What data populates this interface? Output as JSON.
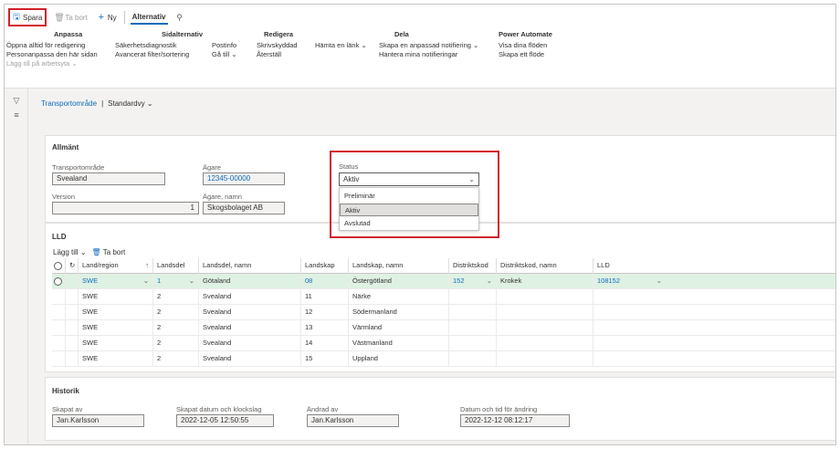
{
  "toolbar": {
    "save": "Spara",
    "delete": "Ta bort",
    "new": "Ny",
    "options_tab": "Alternativ"
  },
  "ribbon": {
    "anpassa": {
      "title": "Anpassa",
      "items": [
        "Öppna alltid för redigering",
        "Personanpassa den här sidan",
        "Lägg till på arbetsyta"
      ]
    },
    "sidalternativ": {
      "title": "Sidalternativ",
      "col1": [
        "Säkerhetsdiagnostik",
        "Avancerat filter/sortering"
      ],
      "col2": [
        "Postinfo",
        "Gå till"
      ]
    },
    "redigera": {
      "title": "Redigera",
      "items": [
        "Skrivskyddad",
        "Återställ"
      ]
    },
    "dela": {
      "title": "Dela",
      "link": "Hämta en länk",
      "items": [
        "Skapa en anpassad notifiering",
        "Hantera mina notifieringar"
      ]
    },
    "power_automate": {
      "title": "Power Automate",
      "items": [
        "Visa dina flöden",
        "Skapa ett flöde"
      ]
    }
  },
  "breadcrumb": {
    "entity": "Transportområde",
    "separator": "|",
    "view": "Standardvy"
  },
  "general": {
    "title": "Allmänt",
    "transport_area_label": "Transportområde",
    "transport_area_value": "Svealand",
    "owner_label": "Ägare",
    "owner_value": "12345-00000",
    "version_label": "Version",
    "version_value": "1",
    "owner_name_label": "Ägare, namn",
    "owner_name_value": "Skogsbolaget AB",
    "status_label": "Status",
    "status_value": "Aktiv",
    "status_options": [
      "Preliminär",
      "Aktiv",
      "Avslutad"
    ]
  },
  "lld": {
    "title": "LLD",
    "add": "Lägg till",
    "remove": "Ta bort",
    "columns": [
      "Land/region",
      "Landsdel",
      "Landsdel, namn",
      "Landskap",
      "Landskap, namn",
      "Distriktskod",
      "Distriktskod, namn",
      "LLD"
    ],
    "rows": [
      [
        "SWE",
        "1",
        "Götaland",
        "08",
        "Östergötland",
        "152",
        "Krokek",
        "108152"
      ],
      [
        "SWE",
        "2",
        "Svealand",
        "11",
        "Närke",
        "",
        "",
        ""
      ],
      [
        "SWE",
        "2",
        "Svealand",
        "12",
        "Södermanland",
        "",
        "",
        ""
      ],
      [
        "SWE",
        "2",
        "Svealand",
        "13",
        "Värmland",
        "",
        "",
        ""
      ],
      [
        "SWE",
        "2",
        "Svealand",
        "14",
        "Västmanland",
        "",
        "",
        ""
      ],
      [
        "SWE",
        "2",
        "Svealand",
        "15",
        "Uppland",
        "",
        "",
        ""
      ]
    ]
  },
  "history": {
    "title": "Historik",
    "created_by_label": "Skapat av",
    "created_by_value": "Jan.Karlsson",
    "created_at_label": "Skapat datum och klockslag",
    "created_at_value": "2022-12-05 12:50:55",
    "modified_by_label": "Ändrad av",
    "modified_by_value": "Jan.Karlsson",
    "modified_at_label": "Datum och tid för ändring",
    "modified_at_value": "2022-12-12 08:12:17"
  },
  "colors": {
    "accent": "#0f6cbd",
    "highlight": "#d1202a",
    "active_row": "#dff1e3"
  }
}
